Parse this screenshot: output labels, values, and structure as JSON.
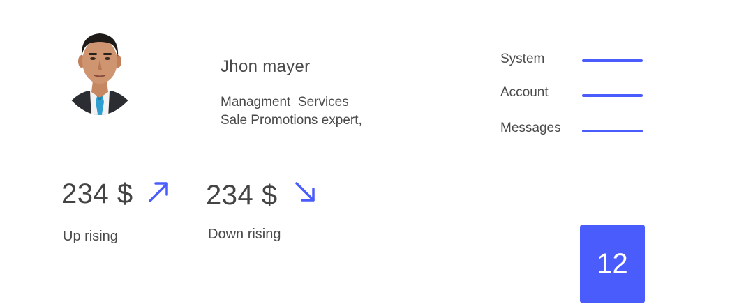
{
  "colors": {
    "accent": "#4a5cfb",
    "text": "#4a4a4a"
  },
  "profile": {
    "name": "Jhon mayer",
    "description": "Managment  Services\nSale Promotions expert,"
  },
  "menu": {
    "items": [
      {
        "label": "System"
      },
      {
        "label": "Account"
      },
      {
        "label": "Messages"
      }
    ]
  },
  "stats": {
    "up": {
      "value": "234 $",
      "label": "Up rising",
      "icon": "arrow-up-right-icon"
    },
    "down": {
      "value": "234 $",
      "label": "Down rising",
      "icon": "arrow-down-right-icon"
    }
  },
  "badge": {
    "value": "12"
  }
}
